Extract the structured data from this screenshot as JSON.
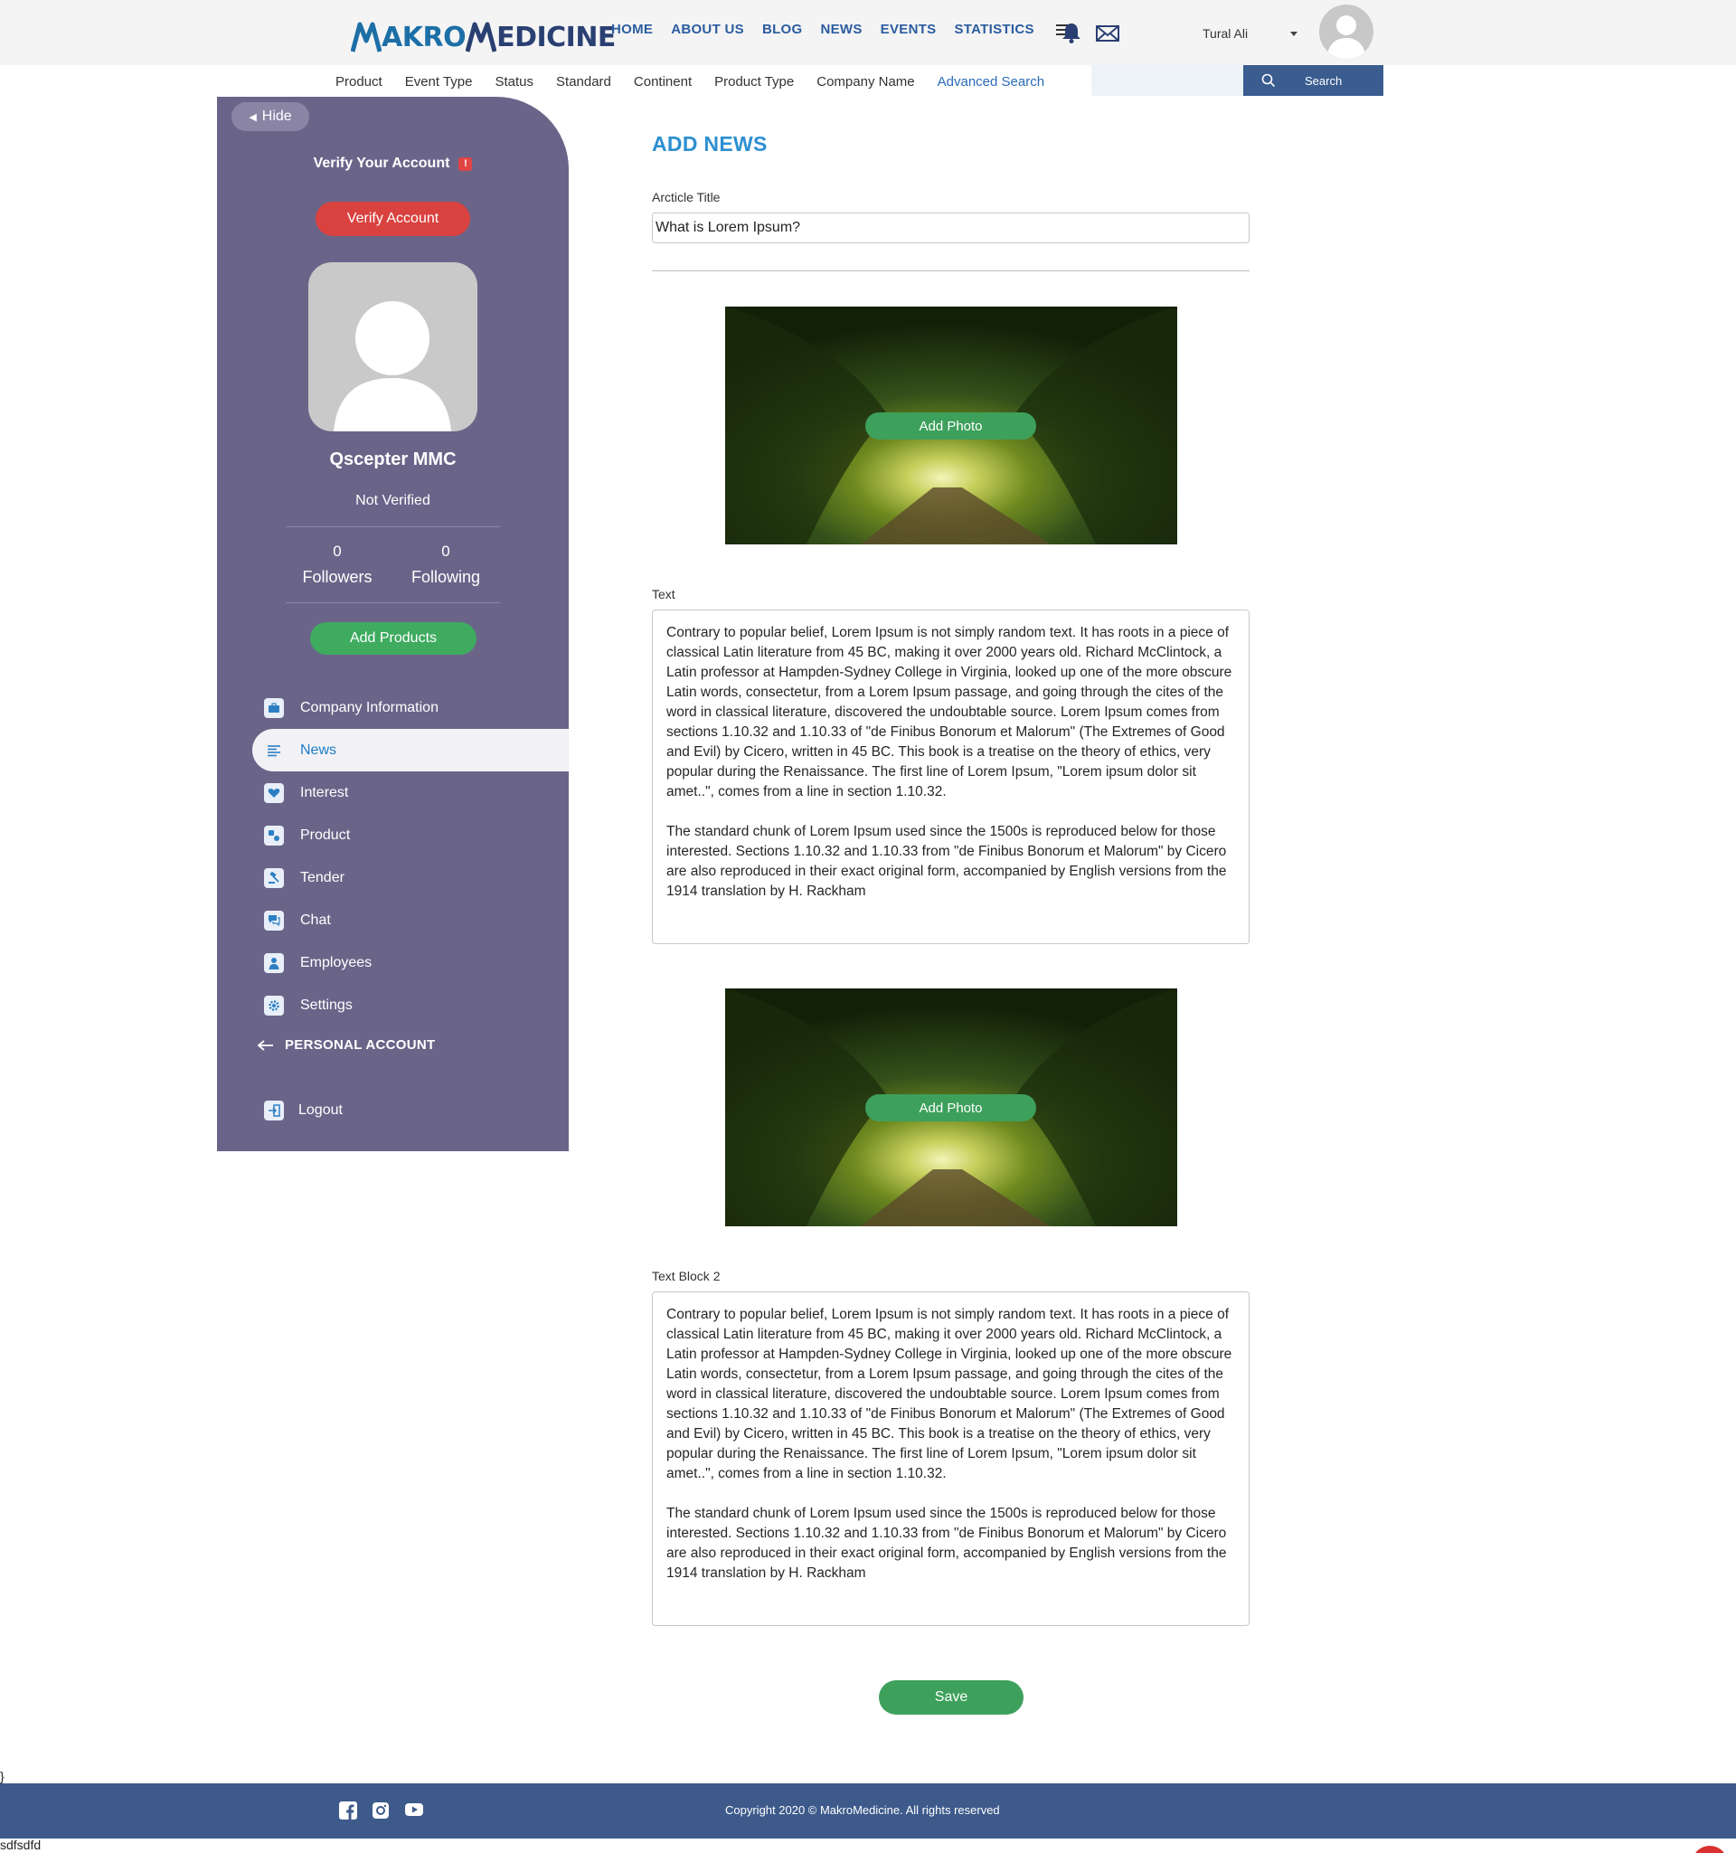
{
  "header": {
    "logo": {
      "part1": "AKRO",
      "part2": "EDICINE",
      "initial1": "M",
      "initial2": "M"
    },
    "nav": [
      "HOME",
      "ABOUT US",
      "BLOG",
      "NEWS",
      "EVENTS",
      "STATISTICS"
    ],
    "user_name": "Tural Ali"
  },
  "filters": {
    "items": [
      "Product",
      "Event Type",
      "Status",
      "Standard",
      "Continent",
      "Product Type",
      "Company Name"
    ],
    "advanced": "Advanced Search",
    "search_value": "",
    "search_button": "Search"
  },
  "sidebar": {
    "hide_label": "Hide",
    "verify_title": "Verify Your Account",
    "warn_mark": "!",
    "verify_button": "Verify Account",
    "company_name": "Qscepter MMC",
    "status": "Not Verified",
    "followers_count": "0",
    "followers_label": "Followers",
    "following_count": "0",
    "following_label": "Following",
    "add_products": "Add Products",
    "menu": [
      {
        "label": "Company Information",
        "icon": "briefcase-icon"
      },
      {
        "label": "News",
        "icon": "news-icon",
        "active": true
      },
      {
        "label": "Interest",
        "icon": "heart-icon"
      },
      {
        "label": "Product",
        "icon": "product-icon"
      },
      {
        "label": "Tender",
        "icon": "gavel-icon"
      },
      {
        "label": "Chat",
        "icon": "chat-icon"
      },
      {
        "label": "Employees",
        "icon": "user-icon"
      },
      {
        "label": "Settings",
        "icon": "gear-icon"
      }
    ],
    "personal_account": "PERSONAL ACCOUNT",
    "logout": "Logout"
  },
  "form": {
    "page_title": "ADD NEWS",
    "title_label": "Arcticle Title",
    "title_value": "What is Lorem Ipsum?",
    "add_photo": "Add Photo",
    "text_label": "Text",
    "text_block_2_label": "Text Block 2",
    "paragraph_1": "Contrary to popular belief, Lorem Ipsum is not simply random text. It has roots in a piece of classical Latin literature from 45 BC, making it over 2000 years old. Richard McClintock, a Latin professor at Hampden-Sydney College in Virginia, looked up one of the more obscure Latin words, consectetur, from a Lorem Ipsum passage, and going through the cites of the word in classical literature, discovered the undoubtable source. Lorem Ipsum comes from sections 1.10.32 and 1.10.33 of \"de Finibus Bonorum et Malorum\" (The Extremes of Good and Evil) by Cicero, written in 45 BC. This book is a treatise on the theory of ethics, very popular during the Renaissance. The first line of Lorem Ipsum, \"Lorem ipsum dolor sit amet..\", comes from a line in section 1.10.32.",
    "paragraph_2": "The standard chunk of Lorem Ipsum used since the 1500s is reproduced below for those interested. Sections 1.10.32 and 1.10.33 from \"de Finibus Bonorum et Malorum\" by Cicero are also reproduced in their exact original form, accompanied by English versions from the 1914 translation by H. Rackham",
    "save_button": "Save"
  },
  "stray_text": "}",
  "footer": {
    "copyright": "Copyright 2020 © MakroMedicine. All rights reserved",
    "social_icons": [
      "facebook-icon",
      "instagram-icon",
      "youtube-icon"
    ],
    "note": "sdfsdfd"
  },
  "colors": {
    "sidebar": "#6b6489",
    "accent_blue": "#2d8fd1",
    "green": "#3da05b",
    "red": "#d9423f",
    "footer": "#3d5a8b"
  }
}
